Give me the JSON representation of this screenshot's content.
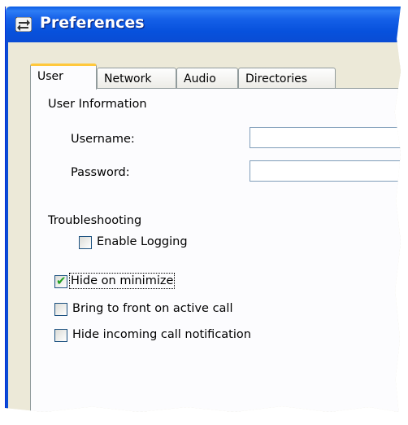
{
  "window": {
    "title": "Preferences"
  },
  "tabs": [
    {
      "label": "User",
      "active": true
    },
    {
      "label": "Network",
      "active": false
    },
    {
      "label": "Audio",
      "active": false
    },
    {
      "label": "Directories",
      "active": false
    }
  ],
  "user_info": {
    "heading": "User Information",
    "username_label": "Username:",
    "username_value": "",
    "password_label": "Password:",
    "password_value": ""
  },
  "troubleshooting": {
    "heading": "Troubleshooting",
    "enable_logging": {
      "label": "Enable Logging",
      "checked": false
    }
  },
  "options": [
    {
      "label": "Hide on minimize",
      "checked": true
    },
    {
      "label": "Bring to front on active call",
      "checked": false
    },
    {
      "label": "Hide incoming call notification",
      "checked": false
    }
  ],
  "colors": {
    "titlebar": "#0a5ce5",
    "dialog_bg": "#ece9d8",
    "active_tab_accent": "#ffc83c",
    "checkmark": "#21a121"
  },
  "icons": {
    "title": "preferences-arrows-icon"
  }
}
